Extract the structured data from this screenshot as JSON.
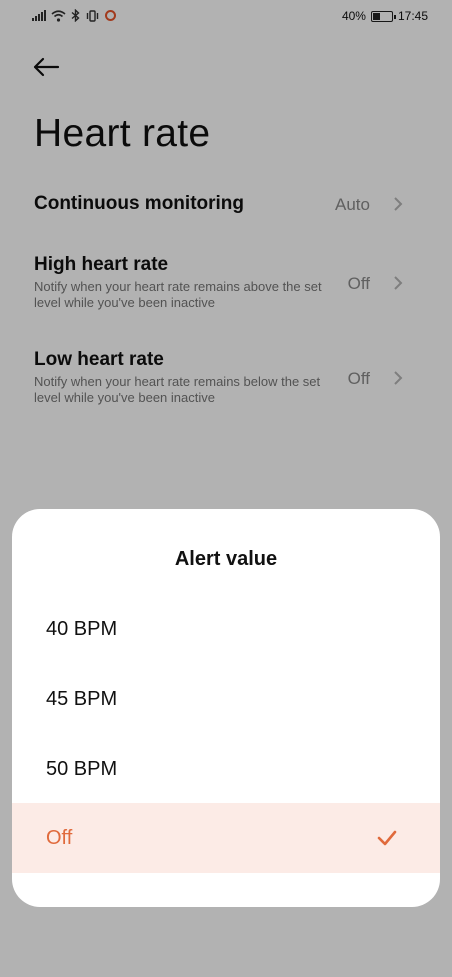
{
  "status_bar": {
    "battery_percent": "40%",
    "time": "17:45",
    "battery_level": 0.4,
    "icons": [
      "signal-icon",
      "wifi-icon",
      "bluetooth-icon",
      "vibrate-icon",
      "recording-icon",
      "battery-icon"
    ]
  },
  "page": {
    "title": "Heart rate",
    "back_icon": "arrow-left-icon"
  },
  "settings": [
    {
      "title": "Continuous monitoring",
      "desc": "",
      "value": "Auto"
    },
    {
      "title": "High heart rate",
      "desc": "Notify when your heart rate remains above the set level while you've been inactive",
      "value": "Off"
    },
    {
      "title": "Low heart rate",
      "desc": "Notify when your heart rate remains below the set level while you've been inactive",
      "value": "Off"
    }
  ],
  "sheet": {
    "title": "Alert value",
    "options": [
      {
        "label": "40 BPM",
        "selected": false
      },
      {
        "label": "45 BPM",
        "selected": false
      },
      {
        "label": "50 BPM",
        "selected": false
      },
      {
        "label": "Off",
        "selected": true
      }
    ]
  },
  "colors": {
    "accent": "#e06a3c",
    "selected_bg": "#fcebe6",
    "record": "#e8542a"
  }
}
